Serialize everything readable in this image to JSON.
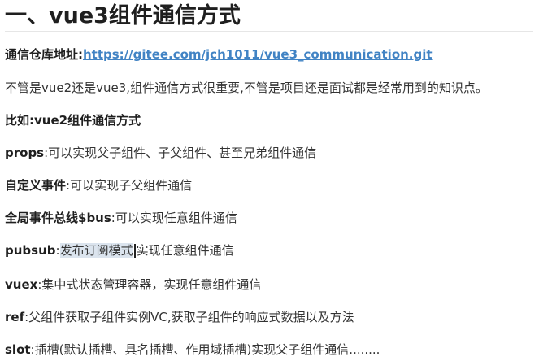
{
  "heading": "一、vue3组件通信方式",
  "repo": {
    "label": "通信仓库地址:",
    "url": "https://gitee.com/jch1011/vue3_communication.git"
  },
  "intro": "不管是vue2还是vue3,组件通信方式很重要,不管是项目还是面试都是经常用到的知识点。",
  "subheading": "比如:vue2组件通信方式",
  "items": [
    {
      "term": "props",
      "desc": ":可以实现父子组件、子父组件、甚至兄弟组件通信"
    },
    {
      "term": "自定义事件",
      "desc": ":可以实现子父组件通信"
    },
    {
      "term": "全局事件总线$bus",
      "desc": ":可以实现任意组件通信"
    },
    {
      "term": "pubsub",
      "desc_prefix": ":",
      "desc_highlight": "发布订阅模式",
      "desc_suffix": "实现任意组件通信"
    },
    {
      "term": "vuex",
      "desc": ":集中式状态管理容器，实现任意组件通信"
    },
    {
      "term": "ref",
      "desc": ":父组件获取子组件实例VC,获取子组件的响应式数据以及方法"
    },
    {
      "term": "slot",
      "desc": ":插槽(默认插槽、具名插槽、作用域插槽)实现父子组件通信........"
    }
  ]
}
